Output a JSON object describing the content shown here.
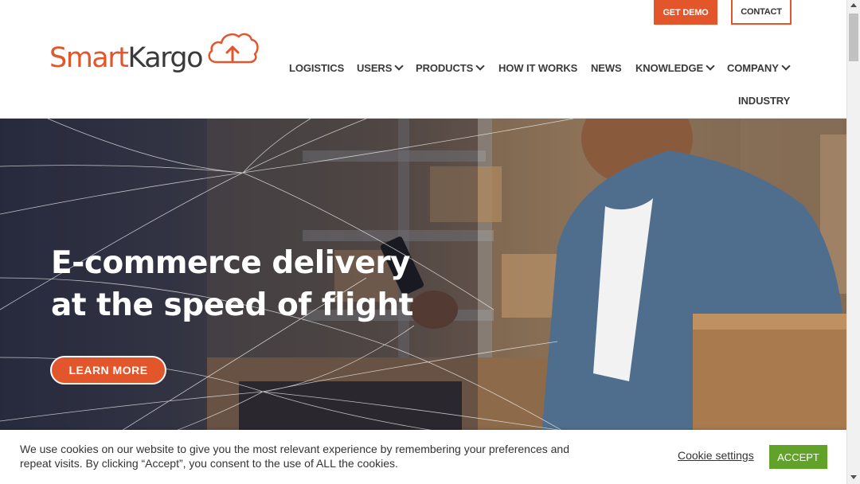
{
  "header": {
    "logo": {
      "part1": "Smart",
      "part2": "Kargo"
    },
    "top_buttons": {
      "demo": "GET DEMO",
      "contact": "CONTACT"
    },
    "nav": [
      {
        "label": "LOGISTICS",
        "dropdown": false
      },
      {
        "label": "USERS",
        "dropdown": true
      },
      {
        "label": "PRODUCTS",
        "dropdown": true
      },
      {
        "label": "HOW IT WORKS",
        "dropdown": false
      },
      {
        "label": "NEWS",
        "dropdown": false
      },
      {
        "label": "KNOWLEDGE",
        "dropdown": true
      },
      {
        "label": "COMPANY",
        "dropdown": true
      },
      {
        "label": "INDUSTRY",
        "dropdown": false
      }
    ]
  },
  "hero": {
    "title_line1": "E-commerce delivery",
    "title_line2": "at the speed of flight",
    "cta": "LEARN MORE"
  },
  "cookie_bar": {
    "text": "We use cookies on our website to give you the most relevant experience by remembering your preferences and repeat visits. By clicking “Accept”, you consent to the use of ALL the cookies.",
    "settings_label": "Cookie settings",
    "accept_label": "ACCEPT"
  },
  "colors": {
    "brand_orange": "#e3552b",
    "accept_green": "#61a229",
    "text_dark": "#3a3a3a"
  }
}
